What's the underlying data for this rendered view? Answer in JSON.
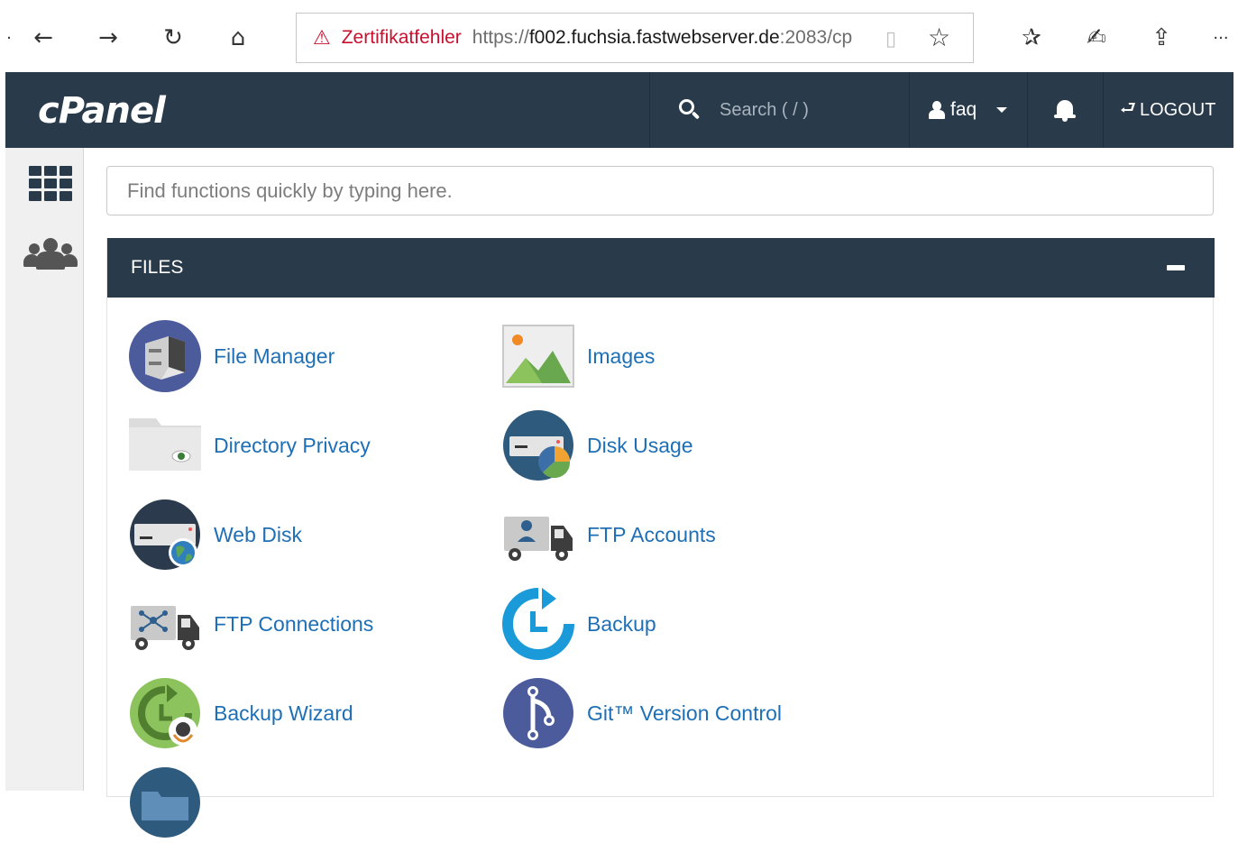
{
  "browser": {
    "back_glyph": "←",
    "forward_glyph": "→",
    "refresh_glyph": "↻",
    "home_glyph": "⌂",
    "warn_glyph": "⚠",
    "cert_error": "Zertifikatfehler",
    "url_scheme": "https://",
    "url_host": "f002.fuchsia.fastwebserver.de",
    "url_rest": ":2083/cp",
    "reader_glyph": "▯",
    "star_glyph": "☆",
    "favorites_glyph": "✰",
    "pen_glyph": "✍",
    "share_glyph": "⇪",
    "more_glyph": "···"
  },
  "header": {
    "logo": "cPanel",
    "search_placeholder": "Search ( / )",
    "user_name": "faq",
    "logout_label": "LOGOUT",
    "logout_glyph": "⮐"
  },
  "quick_find": {
    "placeholder": "Find functions quickly by typing here."
  },
  "files_section": {
    "title": "FILES",
    "items": [
      {
        "label": "File Manager",
        "icon": "file-manager-icon"
      },
      {
        "label": "Images",
        "icon": "images-icon"
      },
      {
        "label": "Directory Privacy",
        "icon": "directory-privacy-icon"
      },
      {
        "label": "Disk Usage",
        "icon": "disk-usage-icon"
      },
      {
        "label": "Web Disk",
        "icon": "web-disk-icon"
      },
      {
        "label": "FTP Accounts",
        "icon": "ftp-accounts-icon"
      },
      {
        "label": "FTP Connections",
        "icon": "ftp-connections-icon"
      },
      {
        "label": "Backup",
        "icon": "backup-icon"
      },
      {
        "label": "Backup Wizard",
        "icon": "backup-wizard-icon"
      },
      {
        "label": "Git™ Version Control",
        "icon": "git-version-control-icon"
      }
    ]
  },
  "colors": {
    "header_bg": "#293a4a",
    "link": "#1e6fb5",
    "cert_error": "#c8102e"
  }
}
